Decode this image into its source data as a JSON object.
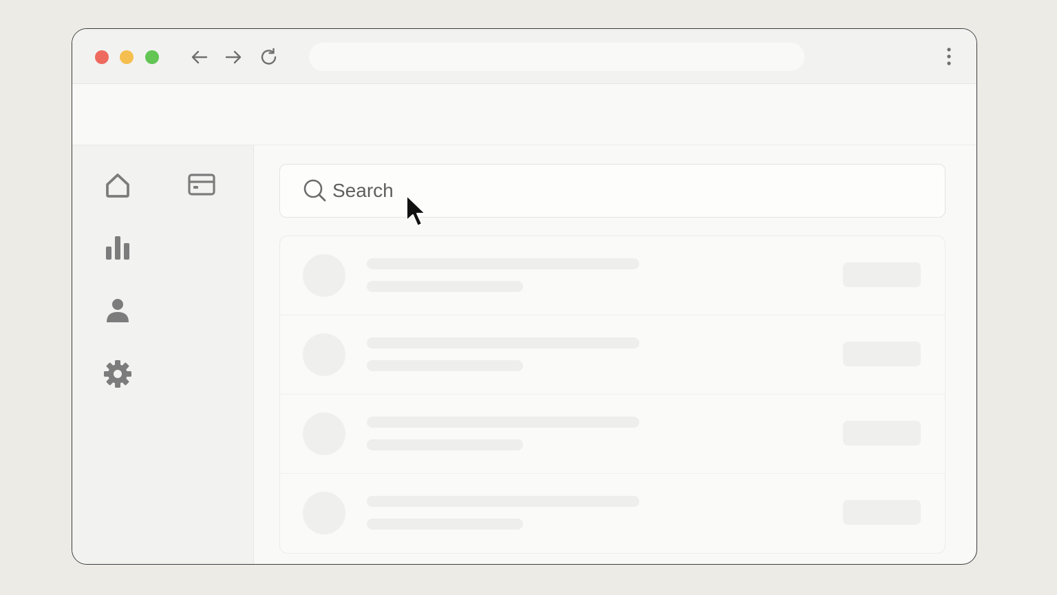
{
  "browser": {
    "window_controls": [
      "close",
      "minimize",
      "maximize"
    ],
    "nav": {
      "back_icon": "arrow-left-icon",
      "forward_icon": "arrow-right-icon",
      "reload_icon": "reload-icon"
    },
    "address": {
      "value": "",
      "placeholder": ""
    },
    "menu_icon": "vertical-ellipsis-icon"
  },
  "sidebar": {
    "items": [
      {
        "icon": "home-icon"
      },
      {
        "icon": "credit-card-icon"
      },
      {
        "icon": "bar-chart-icon"
      },
      {
        "icon": "user-icon"
      },
      {
        "icon": "gear-icon"
      }
    ]
  },
  "search": {
    "placeholder": "Search",
    "value": ""
  },
  "list": {
    "rows": [
      {
        "state": "loading"
      },
      {
        "state": "loading"
      },
      {
        "state": "loading"
      },
      {
        "state": "loading"
      }
    ]
  },
  "colors": {
    "page_bg": "#ecebe6",
    "close": "#ee6a5f",
    "minimize": "#f5bf4f",
    "maximize": "#62c554",
    "icon": "#808080",
    "skeleton": "#eeeeec"
  }
}
